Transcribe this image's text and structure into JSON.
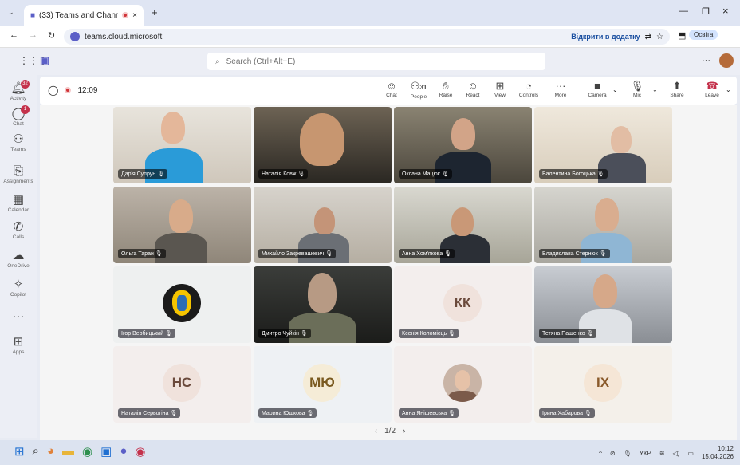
{
  "browser": {
    "tab_title": "(33) Teams and Channels |",
    "url": "teams.cloud.microsoft",
    "open_in_app": "Відкрити в додатку",
    "profile": "Освіта"
  },
  "teams": {
    "search_placeholder": "Search (Ctrl+Alt+E)",
    "rail": [
      {
        "label": "Activity",
        "icon": "bell-icon",
        "badge": "32"
      },
      {
        "label": "Chat",
        "icon": "chat-icon",
        "badge": "1"
      },
      {
        "label": "Teams",
        "icon": "teams-icon",
        "badge": ""
      },
      {
        "label": "Assignments",
        "icon": "assignments-icon",
        "badge": ""
      },
      {
        "label": "Calendar",
        "icon": "calendar-icon",
        "badge": ""
      },
      {
        "label": "Calls",
        "icon": "phone-icon",
        "badge": ""
      },
      {
        "label": "OneDrive",
        "icon": "cloud-icon",
        "badge": ""
      },
      {
        "label": "Copilot",
        "icon": "copilot-icon",
        "badge": ""
      },
      {
        "label": "Apps",
        "icon": "apps-icon",
        "badge": ""
      }
    ]
  },
  "meeting": {
    "timer": "12:09",
    "people_count": "31",
    "controls": [
      "Chat",
      "People",
      "Raise",
      "React",
      "View",
      "Controls",
      "More",
      "Camera",
      "Mic",
      "Share",
      "Leave"
    ],
    "pager": "1/2",
    "participants": [
      "Дар'я Супрун",
      "Наталія Ковж",
      "Оксана Мацюк",
      "Валентина Богоцька",
      "Ольга Таран",
      "Михайло Закревашевич",
      "Анна Хом'якова",
      "Владислава Стернюк",
      "Ігор Вербицький",
      "Дмитро Чуйкін",
      "Ксенія Коломієць",
      "Тетяна Пащенко",
      "Наталія Серьогіна",
      "Марина Юшкова",
      "Анна Янішевська",
      "Ірина Хабарова"
    ],
    "initials": {
      "t10": "КК",
      "t12": "НС",
      "t13": "МЮ",
      "t15": "ІХ"
    }
  },
  "taskbar": {
    "lang": "УКР",
    "time": "10:12",
    "date": "15.04.2026"
  }
}
